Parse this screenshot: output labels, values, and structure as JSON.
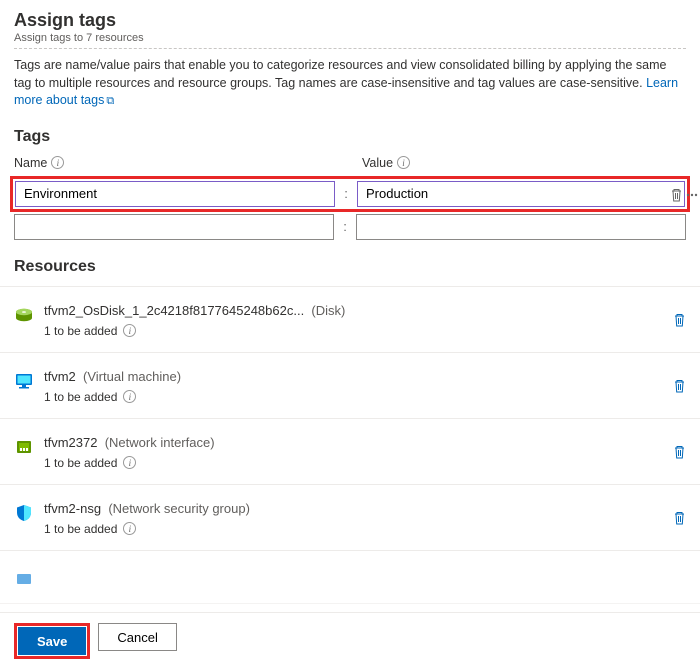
{
  "header": {
    "title": "Assign tags",
    "subtitle": "Assign tags to 7 resources"
  },
  "description": {
    "text": "Tags are name/value pairs that enable you to categorize resources and view consolidated billing by applying the same tag to multiple resources and resource groups. Tag names are case-insensitive and tag values are case-sensitive. ",
    "link_text": "Learn more about tags"
  },
  "tags_section_title": "Tags",
  "name_label": "Name",
  "value_label": "Value",
  "tag_row": {
    "name": "Environment",
    "value": "Production",
    "separator": ":"
  },
  "resources_section_title": "Resources",
  "resources": [
    {
      "name": "tfvm2_OsDisk_1_2c4218f8177645248b62c...",
      "type": "(Disk)",
      "sub": "1 to be added"
    },
    {
      "name": "tfvm2",
      "type": "(Virtual machine)",
      "sub": "1 to be added"
    },
    {
      "name": "tfvm2372",
      "type": "(Network interface)",
      "sub": "1 to be added"
    },
    {
      "name": "tfvm2-nsg",
      "type": "(Network security group)",
      "sub": "1 to be added"
    }
  ],
  "footer": {
    "save": "Save",
    "cancel": "Cancel"
  }
}
